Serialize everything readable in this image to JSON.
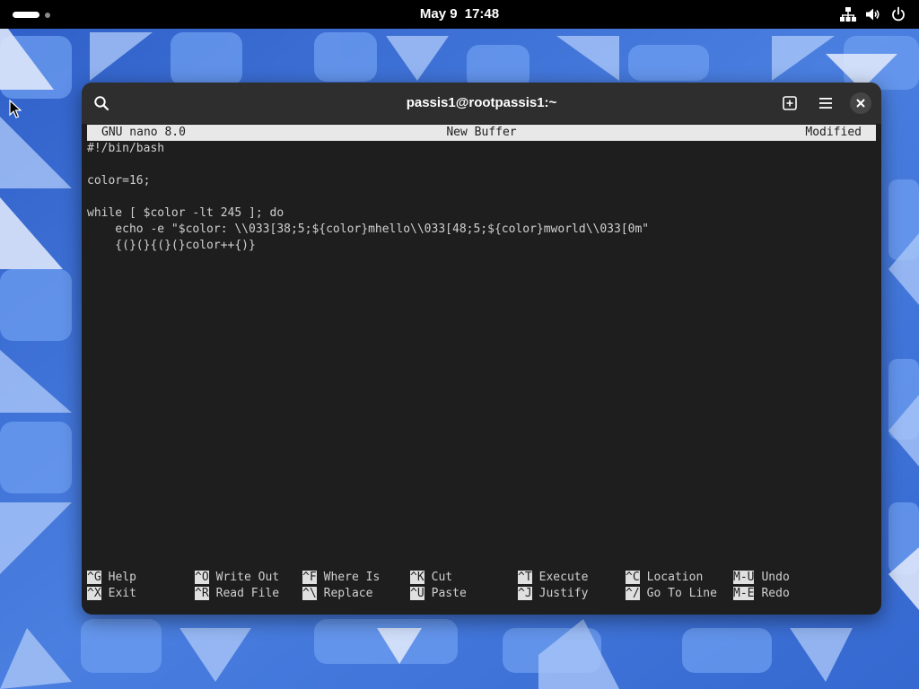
{
  "topbar": {
    "date": "May 9",
    "time": "17:48",
    "tray_icons": [
      "network-icon",
      "volume-icon",
      "power-icon"
    ]
  },
  "window": {
    "title": "passis1@rootpassis1:~",
    "buttons": [
      "search-icon",
      "new-tab-icon",
      "hamburger-menu-icon",
      "close-icon"
    ]
  },
  "nano": {
    "version": "GNU nano 8.0",
    "buffer": "New Buffer",
    "status": "Modified",
    "lines": [
      "#!/bin/bash",
      "",
      "color=16;",
      "",
      "while [ $color -lt 245 ]; do",
      "    echo -e \"$color: \\\\033[38;5;${color}mhello\\\\033[48;5;${color}mworld\\\\033[0m\"",
      "    {(}(}{(}(}color++{)}"
    ],
    "shortcuts_row1": [
      {
        "key": "^G",
        "label": "Help"
      },
      {
        "key": "^O",
        "label": "Write Out"
      },
      {
        "key": "^F",
        "label": "Where Is"
      },
      {
        "key": "^K",
        "label": "Cut"
      },
      {
        "key": "^T",
        "label": "Execute"
      },
      {
        "key": "^C",
        "label": "Location"
      },
      {
        "key": "M-U",
        "label": "Undo"
      }
    ],
    "shortcuts_row2": [
      {
        "key": "^X",
        "label": "Exit"
      },
      {
        "key": "^R",
        "label": "Read File"
      },
      {
        "key": "^\\",
        "label": "Replace"
      },
      {
        "key": "^U",
        "label": "Paste"
      },
      {
        "key": "^J",
        "label": "Justify"
      },
      {
        "key": "^/",
        "label": "Go To Line"
      },
      {
        "key": "M-E",
        "label": "Redo"
      }
    ]
  },
  "colors": {
    "wallpaper_base": "#3f6fd1",
    "terminal_bg": "#1e1e1e",
    "headerbar_bg": "#2e2e2e",
    "nano_text": "#d0d0d0",
    "nano_bar": "#e8e8e8"
  }
}
